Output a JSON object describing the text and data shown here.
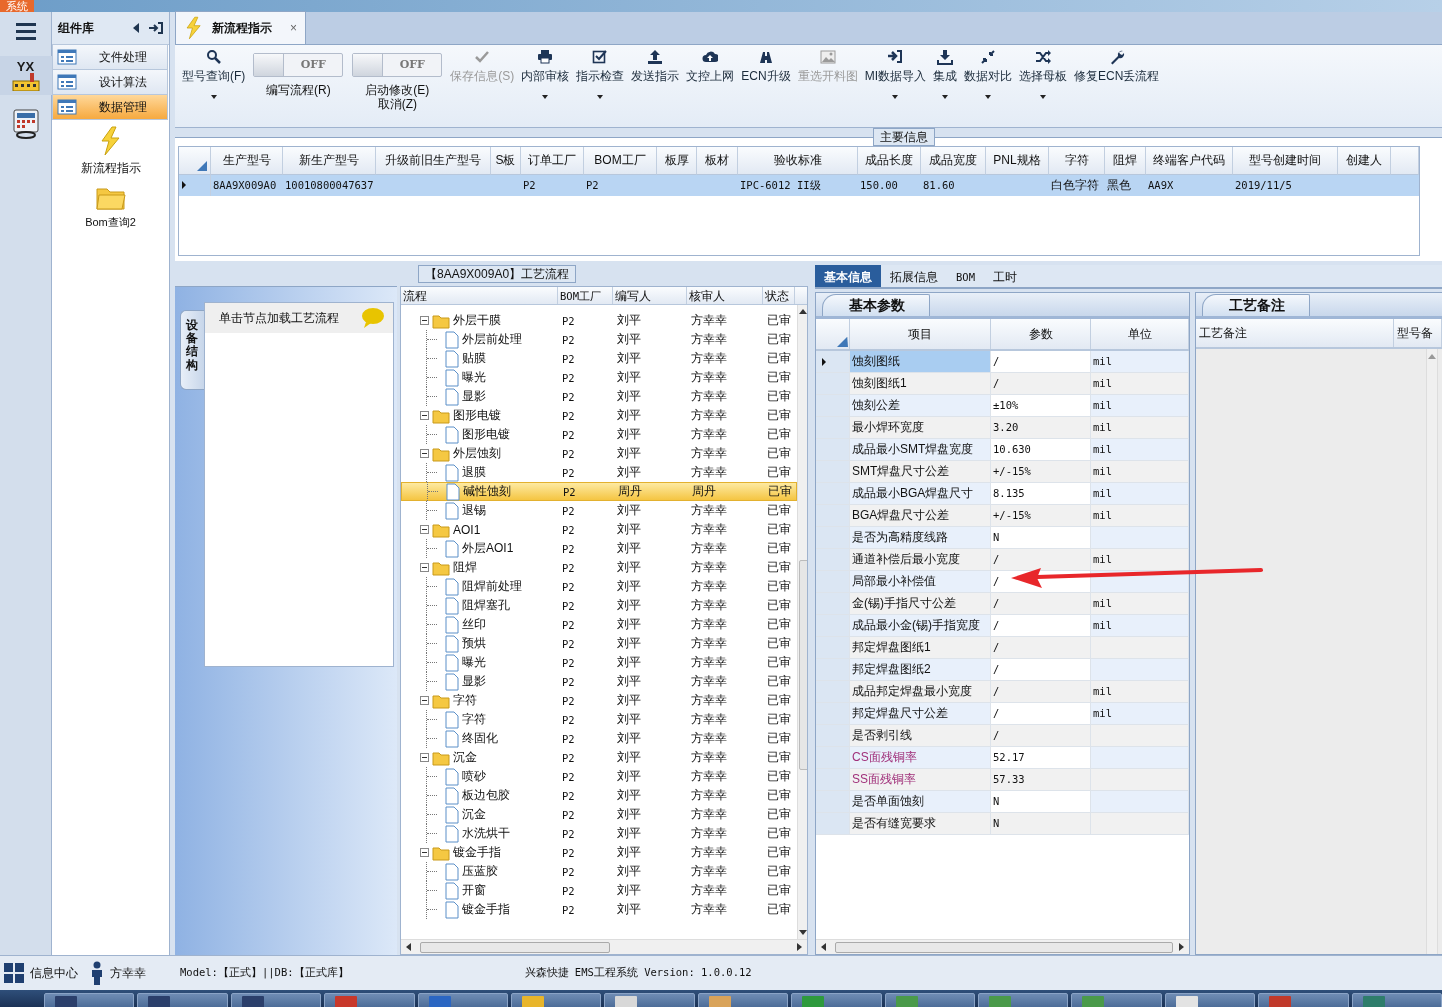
{
  "top_bar": {
    "menu": "系统"
  },
  "rail": {
    "logo_text": "YX"
  },
  "sidebar": {
    "title": "组件库",
    "items": [
      {
        "label": "文件处理",
        "selected": false
      },
      {
        "label": "设计算法",
        "selected": false
      },
      {
        "label": "数据管理",
        "selected": true
      }
    ],
    "launchers": [
      {
        "label": "新流程指示",
        "kind": "lightning"
      },
      {
        "label": "Bom查询2",
        "kind": "folder"
      }
    ]
  },
  "tabs": [
    {
      "label": "新流程指示",
      "selected": true,
      "close": "×"
    }
  ],
  "toolbar": [
    {
      "kind": "button",
      "label": "型号查询(F)",
      "disabled": false,
      "dropdown": true
    },
    {
      "kind": "toggle",
      "label": "编写流程(R)",
      "on": false,
      "switch_text": "OFF"
    },
    {
      "kind": "toggle",
      "label": "启动修改(E)\n取消(Z)",
      "on": false,
      "switch_text": "OFF"
    },
    {
      "kind": "button",
      "label": "保存信息(S)",
      "disabled": true,
      "dropdown": false
    },
    {
      "kind": "button",
      "label": "内部审核",
      "disabled": false,
      "dropdown": true
    },
    {
      "kind": "button",
      "label": "指示检查",
      "disabled": false,
      "dropdown": true
    },
    {
      "kind": "button",
      "label": "发送指示",
      "disabled": false,
      "dropdown": false
    },
    {
      "kind": "button",
      "label": "文控上网",
      "disabled": false,
      "dropdown": false
    },
    {
      "kind": "button",
      "label": "ECN升级",
      "disabled": false,
      "dropdown": false
    },
    {
      "kind": "button",
      "label": "重选开料图",
      "disabled": true,
      "dropdown": false
    },
    {
      "kind": "button",
      "label": "MI数据导入",
      "disabled": false,
      "dropdown": true
    },
    {
      "kind": "button",
      "label": "集成",
      "disabled": false,
      "dropdown": true
    },
    {
      "kind": "button",
      "label": "数据对比",
      "disabled": false,
      "dropdown": true
    },
    {
      "kind": "button",
      "label": "选择母板",
      "disabled": false,
      "dropdown": true
    },
    {
      "kind": "button",
      "label": "修复ECN丢流程",
      "disabled": false,
      "dropdown": false
    }
  ],
  "main_info": {
    "legend": "主要信息",
    "columns": [
      "生产型号",
      "新生产型号",
      "升级前旧生产型号",
      "S板",
      "订单工厂",
      "BOM工厂",
      "板厚",
      "板材",
      "验收标准",
      "成品长度",
      "成品宽度",
      "PNL规格",
      "字符",
      "阻焊",
      "终端客户代码",
      "型号创建时间",
      "创建人"
    ],
    "rows": [
      {
        "selected": true,
        "cells": [
          "8AA9X009A0",
          "10010800047637",
          null,
          null,
          "P2",
          "P2",
          null,
          null,
          "IPC-6012 II级",
          "150.00",
          "81.60",
          null,
          "白色字符",
          "黑色",
          "AA9X",
          "2019/11/5",
          null
        ]
      }
    ]
  },
  "flow": {
    "legend": "【8AA9X009A0】工艺流程",
    "side_tab": "设备结构",
    "hint": "单击节点加载工艺流程",
    "columns": [
      "流程",
      "BOM工厂",
      "编写人",
      "核审人",
      "状态"
    ],
    "nodes": [
      {
        "name": "外层干膜",
        "bom": "P2",
        "writer": "刘平",
        "reviewer": "方幸幸",
        "status": "已审",
        "expanded": true,
        "selected": false,
        "children": [
          {
            "name": "外层前处理",
            "bom": "P2",
            "writer": "刘平",
            "reviewer": "方幸幸",
            "status": "已审",
            "selected": false
          },
          {
            "name": "贴膜",
            "bom": "P2",
            "writer": "刘平",
            "reviewer": "方幸幸",
            "status": "已审",
            "selected": false
          },
          {
            "name": "曝光",
            "bom": "P2",
            "writer": "刘平",
            "reviewer": "方幸幸",
            "status": "已审",
            "selected": false
          },
          {
            "name": "显影",
            "bom": "P2",
            "writer": "刘平",
            "reviewer": "方幸幸",
            "status": "已审",
            "selected": false
          }
        ]
      },
      {
        "name": "图形电镀",
        "bom": "P2",
        "writer": "刘平",
        "reviewer": "方幸幸",
        "status": "已审",
        "expanded": true,
        "selected": false,
        "children": [
          {
            "name": "图形电镀",
            "bom": "P2",
            "writer": "刘平",
            "reviewer": "方幸幸",
            "status": "已审",
            "selected": false
          }
        ]
      },
      {
        "name": "外层蚀刻",
        "bom": "P2",
        "writer": "刘平",
        "reviewer": "方幸幸",
        "status": "已审",
        "expanded": true,
        "selected": false,
        "children": [
          {
            "name": "退膜",
            "bom": "P2",
            "writer": "刘平",
            "reviewer": "方幸幸",
            "status": "已审",
            "selected": false
          },
          {
            "name": "碱性蚀刻",
            "bom": "P2",
            "writer": "周丹",
            "reviewer": "周丹",
            "status": "已审",
            "selected": true
          },
          {
            "name": "退锡",
            "bom": "P2",
            "writer": "刘平",
            "reviewer": "方幸幸",
            "status": "已审",
            "selected": false
          }
        ]
      },
      {
        "name": "AOI1",
        "bom": "P2",
        "writer": "刘平",
        "reviewer": "方幸幸",
        "status": "已审",
        "expanded": true,
        "selected": false,
        "children": [
          {
            "name": "外层AOI1",
            "bom": "P2",
            "writer": "刘平",
            "reviewer": "方幸幸",
            "status": "已审",
            "selected": false
          }
        ]
      },
      {
        "name": "阻焊",
        "bom": "P2",
        "writer": "刘平",
        "reviewer": "方幸幸",
        "status": "已审",
        "expanded": true,
        "selected": false,
        "children": [
          {
            "name": "阻焊前处理",
            "bom": "P2",
            "writer": "刘平",
            "reviewer": "方幸幸",
            "status": "已审",
            "selected": false
          },
          {
            "name": "阻焊塞孔",
            "bom": "P2",
            "writer": "刘平",
            "reviewer": "方幸幸",
            "status": "已审",
            "selected": false
          },
          {
            "name": "丝印",
            "bom": "P2",
            "writer": "刘平",
            "reviewer": "方幸幸",
            "status": "已审",
            "selected": false
          },
          {
            "name": "预烘",
            "bom": "P2",
            "writer": "刘平",
            "reviewer": "方幸幸",
            "status": "已审",
            "selected": false
          },
          {
            "name": "曝光",
            "bom": "P2",
            "writer": "刘平",
            "reviewer": "方幸幸",
            "status": "已审",
            "selected": false
          },
          {
            "name": "显影",
            "bom": "P2",
            "writer": "刘平",
            "reviewer": "方幸幸",
            "status": "已审",
            "selected": false
          }
        ]
      },
      {
        "name": "字符",
        "bom": "P2",
        "writer": "刘平",
        "reviewer": "方幸幸",
        "status": "已审",
        "expanded": true,
        "selected": false,
        "children": [
          {
            "name": "字符",
            "bom": "P2",
            "writer": "刘平",
            "reviewer": "方幸幸",
            "status": "已审",
            "selected": false
          },
          {
            "name": "终固化",
            "bom": "P2",
            "writer": "刘平",
            "reviewer": "方幸幸",
            "status": "已审",
            "selected": false
          }
        ]
      },
      {
        "name": "沉金",
        "bom": "P2",
        "writer": "刘平",
        "reviewer": "方幸幸",
        "status": "已审",
        "expanded": true,
        "selected": false,
        "children": [
          {
            "name": "喷砂",
            "bom": "P2",
            "writer": "刘平",
            "reviewer": "方幸幸",
            "status": "已审",
            "selected": false
          },
          {
            "name": "板边包胶",
            "bom": "P2",
            "writer": "刘平",
            "reviewer": "方幸幸",
            "status": "已审",
            "selected": false
          },
          {
            "name": "沉金",
            "bom": "P2",
            "writer": "刘平",
            "reviewer": "方幸幸",
            "status": "已审",
            "selected": false
          },
          {
            "name": "水洗烘干",
            "bom": "P2",
            "writer": "刘平",
            "reviewer": "方幸幸",
            "status": "已审",
            "selected": false
          }
        ]
      },
      {
        "name": "镀金手指",
        "bom": "P2",
        "writer": "刘平",
        "reviewer": "方幸幸",
        "status": "已审",
        "expanded": true,
        "selected": false,
        "children": [
          {
            "name": "压蓝胶",
            "bom": "P2",
            "writer": "刘平",
            "reviewer": "方幸幸",
            "status": "已审",
            "selected": false
          },
          {
            "name": "开窗",
            "bom": "P2",
            "writer": "刘平",
            "reviewer": "方幸幸",
            "status": "已审",
            "selected": false
          },
          {
            "name": "镀金手指",
            "bom": "P2",
            "writer": "刘平",
            "reviewer": "方幸幸",
            "status": "已审",
            "selected": false
          }
        ]
      }
    ]
  },
  "details": {
    "tabs": [
      {
        "label": "基本信息",
        "selected": true
      },
      {
        "label": "拓展信息",
        "selected": false
      },
      {
        "label": "BOM",
        "selected": false
      },
      {
        "label": "工时",
        "selected": false
      }
    ],
    "params": {
      "title": "基本参数",
      "columns": [
        "项目",
        "参数",
        "单位"
      ],
      "rows": [
        {
          "item": "蚀刻图纸",
          "value": "/",
          "unit": "mil",
          "selected": true,
          "emphasis": false
        },
        {
          "item": "蚀刻图纸1",
          "value": "/",
          "unit": "mil",
          "selected": false,
          "emphasis": false
        },
        {
          "item": "蚀刻公差",
          "value": "±10%",
          "unit": "mil",
          "selected": false,
          "emphasis": false
        },
        {
          "item": "最小焊环宽度",
          "value": "3.20",
          "unit": "mil",
          "selected": false,
          "emphasis": false
        },
        {
          "item": "成品最小SMT焊盘宽度",
          "value": "10.630",
          "unit": "mil",
          "selected": false,
          "emphasis": false
        },
        {
          "item": "SMT焊盘尺寸公差",
          "value": "+/-15%",
          "unit": "mil",
          "selected": false,
          "emphasis": false
        },
        {
          "item": "成品最小BGA焊盘尺寸",
          "value": "8.135",
          "unit": "mil",
          "selected": false,
          "emphasis": false
        },
        {
          "item": "BGA焊盘尺寸公差",
          "value": "+/-15%",
          "unit": "mil",
          "selected": false,
          "emphasis": false
        },
        {
          "item": "是否为高精度线路",
          "value": "N",
          "selected": false,
          "emphasis": false
        },
        {
          "item": "通道补偿后最小宽度",
          "value": "/",
          "unit": "mil",
          "selected": false,
          "emphasis": false
        },
        {
          "item": "局部最小补偿值",
          "value": "/",
          "selected": false,
          "emphasis": false
        },
        {
          "item": "金(锡)手指尺寸公差",
          "value": "/",
          "unit": "mil",
          "selected": false,
          "emphasis": false
        },
        {
          "item": "成品最小金(锡)手指宽度",
          "value": "/",
          "unit": "mil",
          "selected": false,
          "emphasis": false
        },
        {
          "item": "邦定焊盘图纸1",
          "value": "/",
          "selected": false,
          "emphasis": false
        },
        {
          "item": "邦定焊盘图纸2",
          "value": "/",
          "selected": false,
          "emphasis": false
        },
        {
          "item": "成品邦定焊盘最小宽度",
          "value": "/",
          "unit": "mil",
          "selected": false,
          "emphasis": false
        },
        {
          "item": "邦定焊盘尺寸公差",
          "value": "/",
          "unit": "mil",
          "selected": false,
          "emphasis": false
        },
        {
          "item": "是否剥引线",
          "value": "/",
          "selected": false,
          "emphasis": false
        },
        {
          "item": "CS面残铜率",
          "value": "52.17",
          "selected": false,
          "emphasis": true
        },
        {
          "item": "SS面残铜率",
          "value": "57.33",
          "selected": false,
          "emphasis": true
        },
        {
          "item": "是否单面蚀刻",
          "value": "N",
          "selected": false,
          "emphasis": false
        },
        {
          "item": "是否有缝宽要求",
          "value": "N",
          "selected": false,
          "emphasis": false
        }
      ]
    },
    "notes": {
      "title": "工艺备注",
      "columns": [
        "工艺备注",
        "型号备"
      ]
    }
  },
  "status_bar": {
    "info_center": "信息中心",
    "user": "方幸幸",
    "db": "Model:【正式】||DB:【正式库】",
    "version": "兴森快捷 EMS工程系统 Version: 1.0.0.12"
  }
}
